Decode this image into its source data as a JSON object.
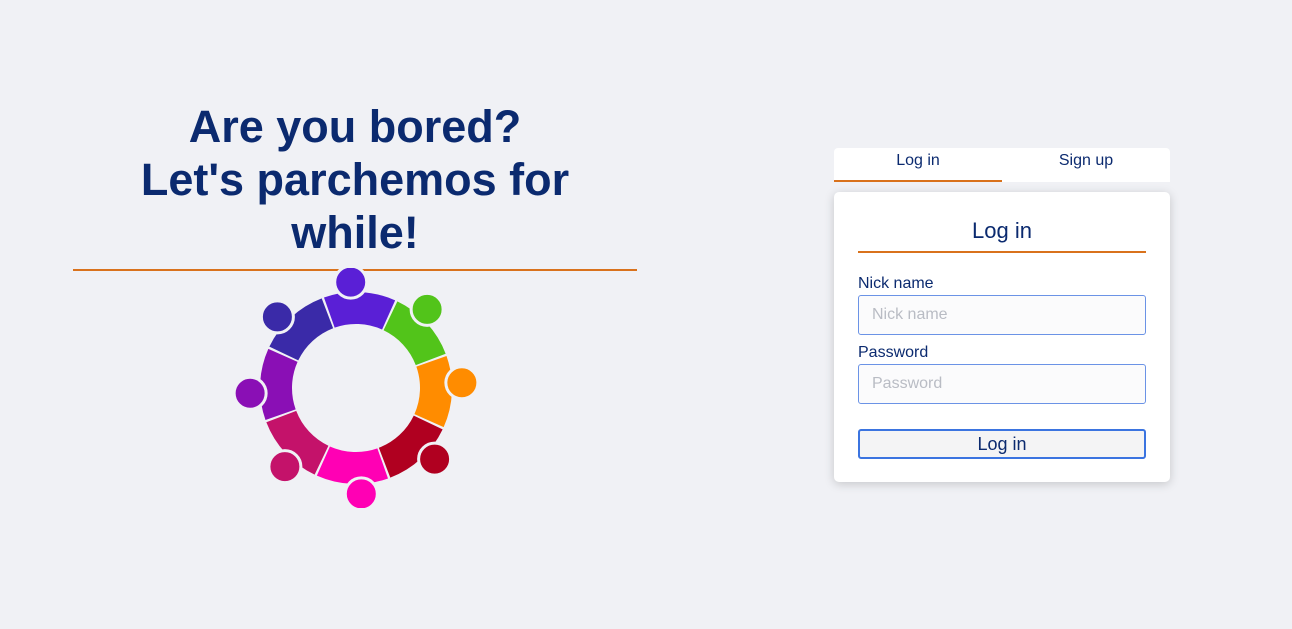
{
  "hero": {
    "line1": "Are you bored?",
    "line2": "Let's parchemos for while!"
  },
  "logo": {
    "icon": "people-circle-icon"
  },
  "tabs": [
    {
      "label": "Log in",
      "active": true
    },
    {
      "label": "Sign up",
      "active": false
    }
  ],
  "login_form": {
    "title": "Log in",
    "nickname_label": "Nick name",
    "nickname_placeholder": "Nick name",
    "nickname_value": "",
    "password_label": "Password",
    "password_placeholder": "Password",
    "password_value": "",
    "submit_label": "Log in"
  },
  "colors": {
    "background": "#f0f1f5",
    "text": "#0b2a6f",
    "accent": "#d9721c",
    "input_border": "#6b93e6",
    "button_border": "#3b74e0"
  }
}
